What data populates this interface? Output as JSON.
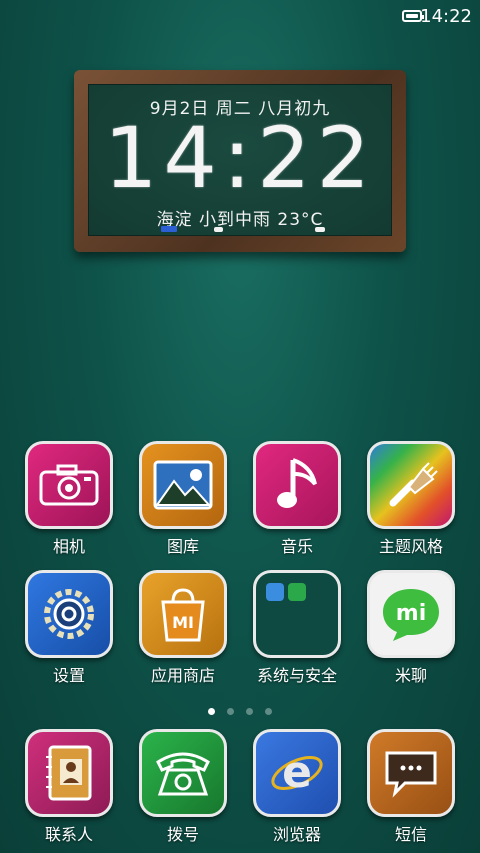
{
  "status_bar": {
    "time": "14:22",
    "battery_icon": "battery-full-icon"
  },
  "clock_widget": {
    "date_line": "9月2日  周二  八月初九",
    "time": "14:22",
    "weather_line": "海淀  小到中雨  23°C"
  },
  "apps_row1": [
    {
      "label": "相机",
      "icon": "camera-icon",
      "bg": "#c2186e"
    },
    {
      "label": "图库",
      "icon": "picture-icon",
      "bg": "#d07a1a"
    },
    {
      "label": "音乐",
      "icon": "music-note-icon",
      "bg": "#c2185b"
    },
    {
      "label": "主题风格",
      "icon": "paint-brush-icon",
      "bg": "#e0502f"
    }
  ],
  "apps_row2": [
    {
      "label": "设置",
      "icon": "gear-icon",
      "bg": "#1f63c9"
    },
    {
      "label": "应用商店",
      "icon": "shopping-bag-icon",
      "bg": "#d9861c"
    },
    {
      "label": "系统与安全",
      "icon": "folder-icon",
      "bg": "#0f4a42"
    },
    {
      "label": "米聊",
      "icon": "mi-chat-icon",
      "bg": "#f3f3f3"
    }
  ],
  "dock": [
    {
      "label": "联系人",
      "icon": "contacts-book-icon",
      "bg": "#b0256a"
    },
    {
      "label": "拨号",
      "icon": "telephone-icon",
      "bg": "#1f9a3a"
    },
    {
      "label": "浏览器",
      "icon": "browser-e-icon",
      "bg": "#2a5fcf"
    },
    {
      "label": "短信",
      "icon": "message-bubble-icon",
      "bg": "#b8651e"
    }
  ],
  "pager": {
    "pages": 4,
    "current": 1
  }
}
